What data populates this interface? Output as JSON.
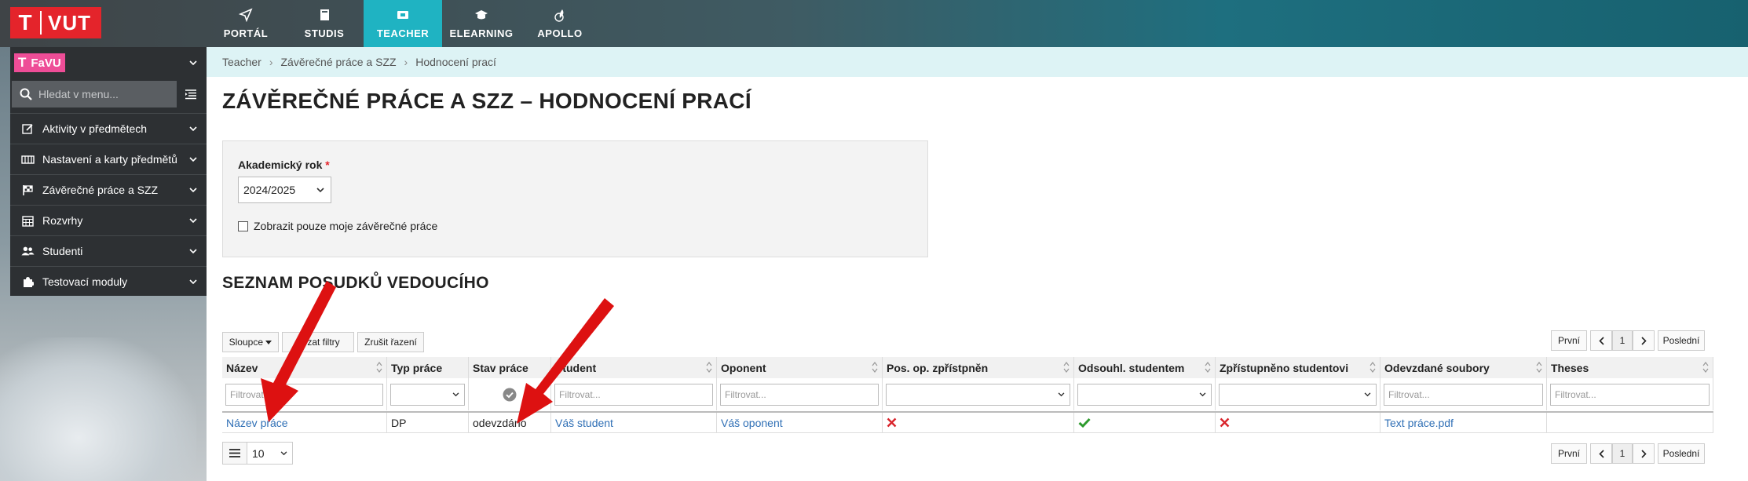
{
  "brand": {
    "logo_text": "VUT",
    "faculty": "FaVU"
  },
  "nav": [
    {
      "label": "PORTÁL",
      "icon": "paper-plane-icon",
      "active": false
    },
    {
      "label": "STUDIS",
      "icon": "book-icon",
      "active": false
    },
    {
      "label": "TEACHER",
      "icon": "teacher-icon",
      "active": true
    },
    {
      "label": "ELEARNING",
      "icon": "graduation-cap-icon",
      "active": false
    },
    {
      "label": "APOLLO",
      "icon": "rocket-icon",
      "active": false
    }
  ],
  "sidebar": {
    "search_placeholder": "Hledat v menu...",
    "items": [
      {
        "label": "Aktivity v předmětech",
        "icon": "edit-icon"
      },
      {
        "label": "Nastavení a karty předmětů",
        "icon": "cards-icon"
      },
      {
        "label": "Závěrečné práce a SZZ",
        "icon": "flag-icon"
      },
      {
        "label": "Rozvrhy",
        "icon": "calendar-icon"
      },
      {
        "label": "Studenti",
        "icon": "users-icon"
      },
      {
        "label": "Testovací moduly",
        "icon": "puzzle-icon"
      }
    ]
  },
  "breadcrumb": [
    "Teacher",
    "Závěrečné práce a SZZ",
    "Hodnocení prací"
  ],
  "page_title": "ZÁVĚREČNÉ PRÁCE A SZZ – HODNOCENÍ PRACÍ",
  "filter": {
    "year_label": "Akademický rok",
    "required_mark": "*",
    "year_value": "2024/2025",
    "checkbox_label": "Zobrazit pouze moje závěrečné práce"
  },
  "section_title": "SEZNAM POSUDKŮ VEDOUCÍHO",
  "toolbar": {
    "columns_label": "Sloupce",
    "filters_label": "zat filtry",
    "reset_sort_label": "Zrušit řazení"
  },
  "pager": {
    "first": "První",
    "page": "1",
    "last": "Poslední"
  },
  "table": {
    "filter_placeholder": "Filtrovat...",
    "columns": [
      "Název",
      "Typ práce",
      "Stav práce",
      "Student",
      "Oponent",
      "Pos. op. zpřístpněn",
      "Odsouhl. studentem",
      "Zpřístupněno studentovi",
      "Odevzdané soubory",
      "Theses"
    ],
    "row": {
      "name": "Název práce",
      "type": "DP",
      "state": "odevzdáno",
      "student": "Váš student",
      "opponent": "Váš oponent",
      "file": "Text práce.pdf",
      "pos_op_icon": "cross-icon",
      "approved_icon": "check-icon",
      "accessible_icon": "cross-icon"
    }
  },
  "page_size": "10",
  "colors": {
    "accent": "#1fb3c2",
    "brand_red": "#e4242b",
    "link": "#2f6fb5",
    "check": "#2e9b2e",
    "annotation_arrow": "#dd1111"
  }
}
